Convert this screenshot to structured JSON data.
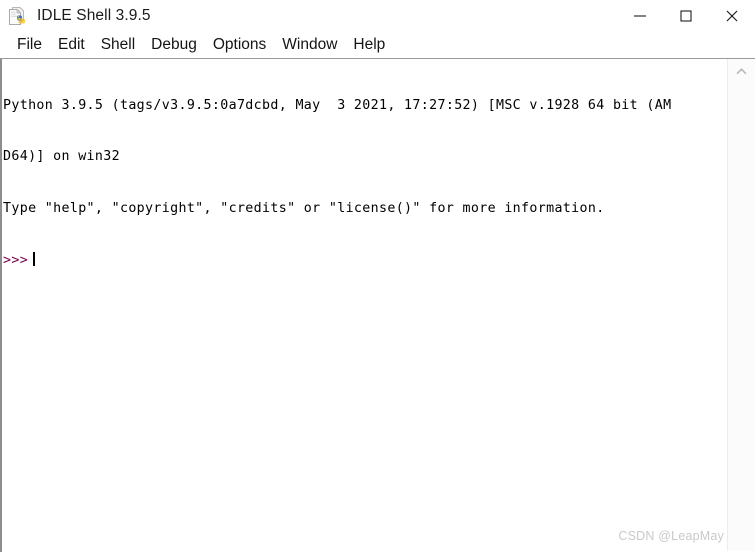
{
  "window": {
    "title": "IDLE Shell 3.9.5",
    "icon": "python-document-icon",
    "controls": {
      "minimize": "minimize-icon",
      "maximize": "maximize-icon",
      "close": "close-icon"
    }
  },
  "menubar": {
    "items": [
      {
        "label": "File"
      },
      {
        "label": "Edit"
      },
      {
        "label": "Shell"
      },
      {
        "label": "Debug"
      },
      {
        "label": "Options"
      },
      {
        "label": "Window"
      },
      {
        "label": "Help"
      }
    ]
  },
  "console": {
    "lines": [
      "Python 3.9.5 (tags/v3.9.5:0a7dcbd, May  3 2021, 17:27:52) [MSC v.1928 64 bit (AM",
      "D64)] on win32",
      "Type \"help\", \"copyright\", \"credits\" or \"license()\" for more information."
    ],
    "prompt": ">>>",
    "prompt_color": "#76004c",
    "input_value": "",
    "background": "#ffffff",
    "text_color": "#000000"
  },
  "scrollbar": {
    "up_arrow": "chevron-up-icon",
    "track_color": "#fbfbfb"
  },
  "watermark": {
    "text": "CSDN @LeapMay"
  }
}
